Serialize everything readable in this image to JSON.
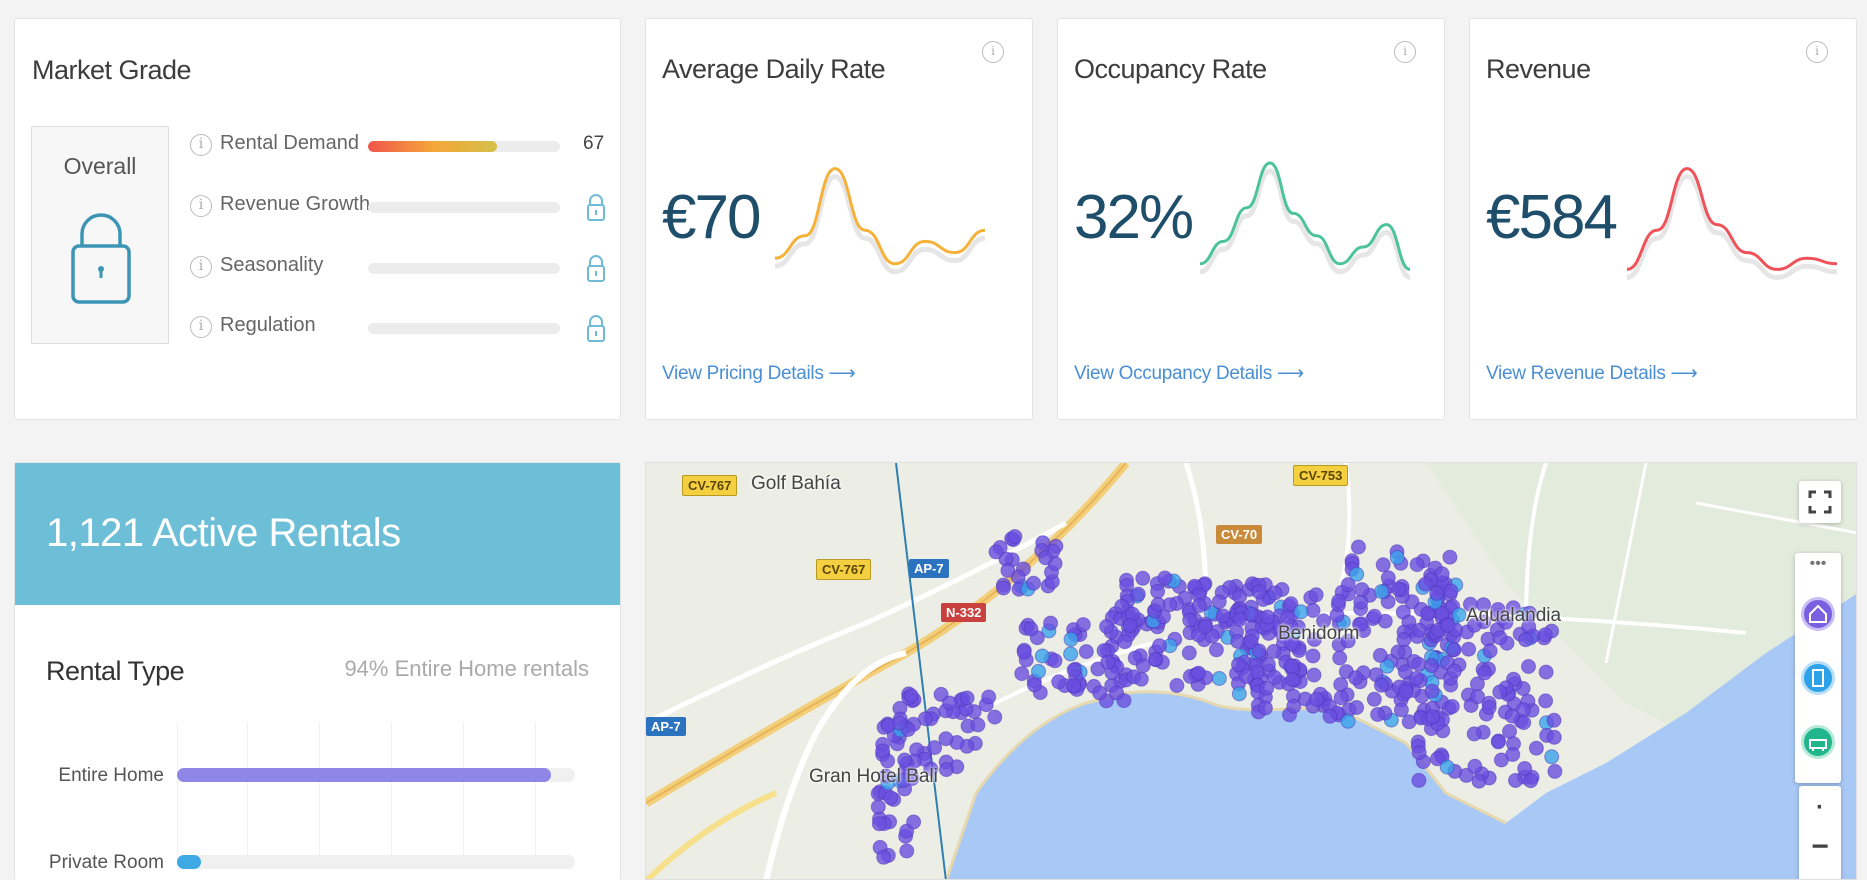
{
  "market_grade": {
    "title": "Market Grade",
    "overall_label": "Overall",
    "rows": [
      {
        "label": "Rental Demand",
        "value": "67",
        "level": 0.67,
        "locked": false
      },
      {
        "label": "Revenue Growth",
        "value": "",
        "locked": true
      },
      {
        "label": "Seasonality",
        "value": "",
        "locked": true
      },
      {
        "label": "Regulation",
        "value": "",
        "locked": true
      }
    ]
  },
  "metrics": [
    {
      "title": "Average Daily Rate",
      "value": "€70",
      "link": "View Pricing Details ⟶",
      "color": "#f5b13a",
      "trend": [
        0.15,
        0.35,
        0.95,
        0.4,
        0.1,
        0.3,
        0.2,
        0.4
      ]
    },
    {
      "title": "Occupancy Rate",
      "value": "32%",
      "link": "View Occupancy Details ⟶",
      "color": "#4cc39a",
      "trend": [
        0.1,
        0.3,
        0.6,
        1.0,
        0.55,
        0.35,
        0.1,
        0.25,
        0.45,
        0.05
      ]
    },
    {
      "title": "Revenue",
      "value": "€584",
      "link": "View Revenue Details ⟶",
      "color": "#f0525a",
      "trend": [
        0.05,
        0.4,
        0.95,
        0.45,
        0.2,
        0.05,
        0.15,
        0.1
      ]
    }
  ],
  "rentals": {
    "title": "1,121 Active Rentals",
    "rental_type_title": "Rental Type",
    "rental_type_note": "94% Entire Home rentals",
    "bars": [
      {
        "label": "Entire Home",
        "level": 0.94,
        "color": "#8f86e8"
      },
      {
        "label": "Private Room",
        "level": 0.05,
        "color": "#3fa9e6"
      }
    ]
  },
  "map": {
    "roads": [
      "CV-767",
      "CV-753",
      "CV-70",
      "CV-767",
      "AP-7",
      "N-332",
      "AP-7"
    ],
    "places": [
      "Golf Bahía",
      "Benidorm",
      "Aqualandia",
      "Gran Hotel Bali"
    ],
    "controls": {
      "fullscreen": "fullscreen-icon",
      "more": "•••",
      "zoom_out": "−",
      "zoom_dot": "·"
    }
  },
  "colors": {
    "accent_blue": "#6dbfd8",
    "marker_purple": "#6a4fe0",
    "marker_blue": "#3aa3ea",
    "sea": "#a8c8f5"
  }
}
